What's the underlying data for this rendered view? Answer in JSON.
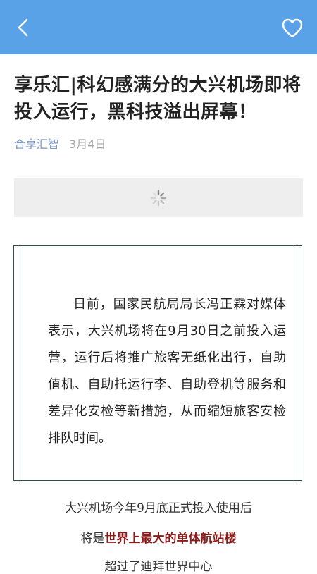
{
  "header": {
    "back_icon": "chevron-left-icon",
    "favorite_icon": "heart-outline-icon",
    "bg_color": "#5aa2e8"
  },
  "article": {
    "title": "享乐汇|科幻感满分的大兴机场即将投入运行，黑科技溢出屏幕！",
    "author": "合享汇智",
    "date": "3月4日",
    "loader_icon": "spinner-icon",
    "body_paragraph": "日前，国家民航局局长冯正霖对媒体表示，大兴机场将在9月30日之前投入运营，运行后将推广旅客无纸化出行，自助值机、自助托运行李、自助登机等服务和差异化安检等新措施，从而缩短旅客安检排队时间。",
    "caption_line1": "大兴机场今年9月底正式投入使用后",
    "caption_line2_prefix": "将是",
    "caption_line2_highlight": "世界上最大的单体航站楼",
    "caption_line3": "超过了迪拜世界中心"
  }
}
